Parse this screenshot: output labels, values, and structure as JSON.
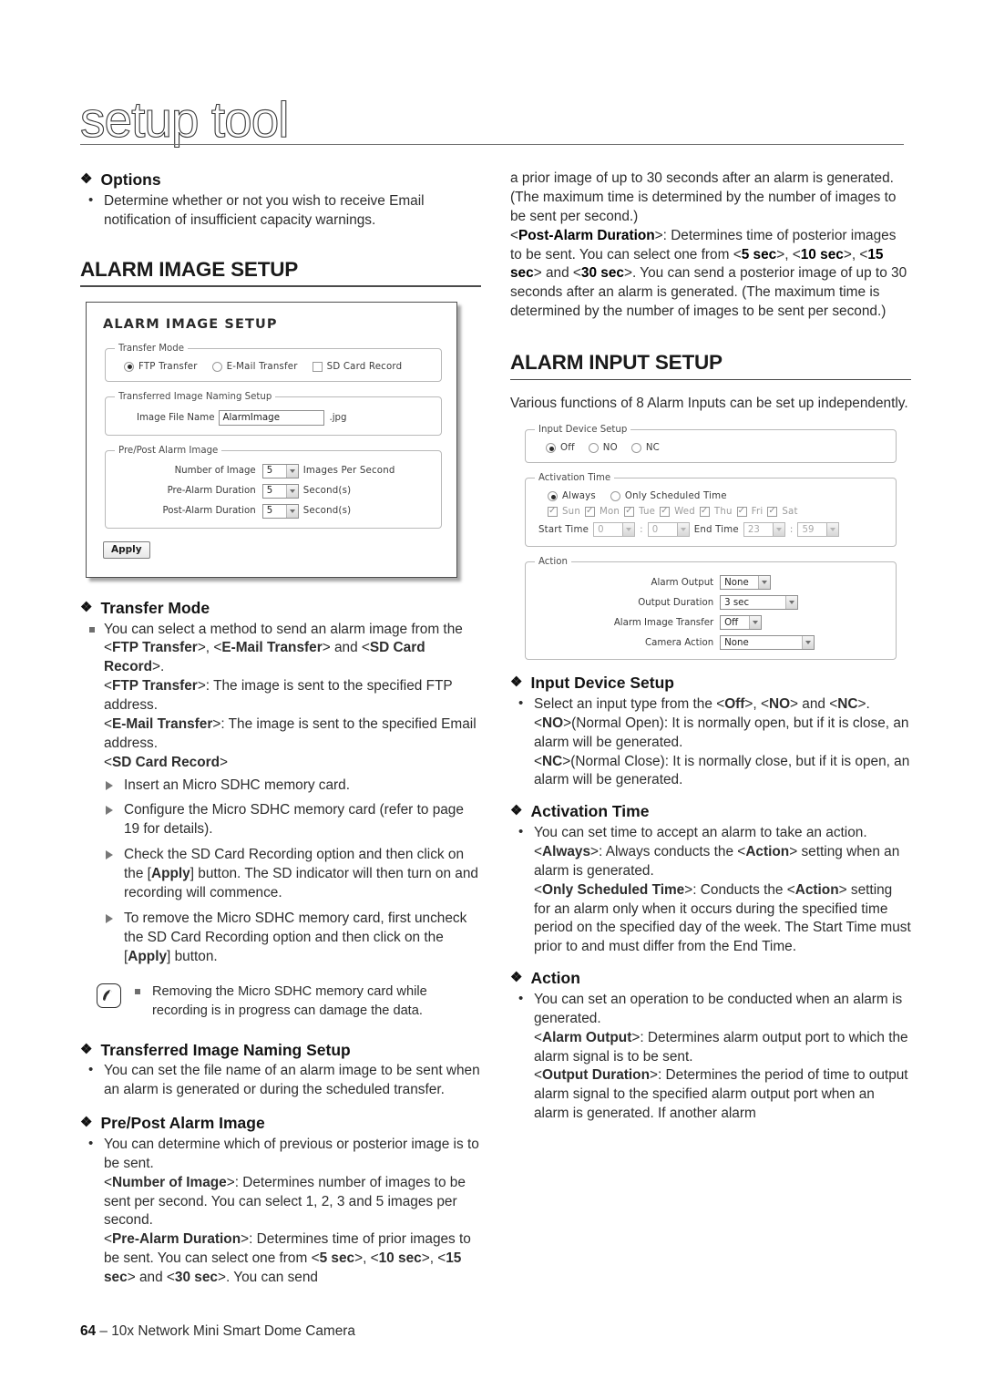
{
  "page": {
    "title": "setup tool",
    "footer_page_number": "64",
    "footer_dash": "–",
    "footer_text": "10x Network Mini Smart Dome Camera"
  },
  "left": {
    "options": {
      "heading": "Options",
      "bullets": [
        "Determine whether or not you wish to receive Email notification of insufficient capacity warnings."
      ]
    },
    "alarm_image_setup": {
      "heading": "ALARM IMAGE SETUP"
    },
    "shot_alarm_image": {
      "title": "ALARM IMAGE SETUP",
      "transfer_mode": {
        "legend": "Transfer Mode",
        "ftp_label": "FTP Transfer",
        "ftp_selected": true,
        "email_label": "E-Mail Transfer",
        "email_selected": false,
        "sd_label": "SD Card Record",
        "sd_checked": false
      },
      "naming": {
        "legend": "Transferred Image Naming Setup",
        "file_name_label": "Image File Name",
        "file_name_value": "AlarmImage",
        "extension": ".jpg"
      },
      "prepost": {
        "legend": "Pre/Post Alarm Image",
        "number_label": "Number of Image",
        "number_value": "5",
        "number_suffix": "Images Per Second",
        "pre_label": "Pre-Alarm Duration",
        "pre_value": "5",
        "pre_suffix": "Second(s)",
        "post_label": "Post-Alarm Duration",
        "post_value": "5",
        "post_suffix": "Second(s)"
      },
      "apply_label": "Apply"
    },
    "transfer_mode": {
      "heading": "Transfer Mode",
      "p1_a": "You can select a method to send an alarm image from the <",
      "p1_b": "FTP Transfer",
      "p1_c": ">, <",
      "p1_d": "E-Mail Transfer",
      "p1_e": "> and <",
      "p1_f": "SD Card Record",
      "p1_g": ">.",
      "p2_a": "<",
      "p2_b": "FTP Transfer",
      "p2_c": ">: The image is sent to the specified FTP address.",
      "p3_a": "<",
      "p3_b": "E-Mail Transfer",
      "p3_c": ">: The image is sent to the specified Email address.",
      "p4_a": "<",
      "p4_b": "SD Card Record",
      "p4_c": ">",
      "steps": [
        "Insert an Micro SDHC memory card.",
        "Configure the Micro SDHC memory card (refer to page 19 for details).",
        "Check the SD Card Recording option and then click on the [Apply] button. The SD indicator will then turn on and recording will commence.",
        "To remove the Micro SDHC memory card, first uncheck the SD Card Recording option and then click on the [Apply] button."
      ],
      "step3_a": "Check the SD Card Recording option and then click on the [",
      "step3_b": "Apply",
      "step3_c": "] button. The SD indicator will then turn on and recording will commence.",
      "step4_a": "To remove the Micro SDHC memory card, first uncheck the SD Card Recording option and then click on the [",
      "step4_b": "Apply",
      "step4_c": "] button."
    },
    "note": {
      "icon": "note-pen-icon",
      "text": "Removing the Micro SDHC memory card while recording is in progress can damage the data."
    },
    "naming_setup": {
      "heading": "Transferred Image Naming Setup",
      "bullet": "You can set the file name of an alarm image to be sent when an alarm is generated or during the scheduled transfer."
    },
    "prepost_alarm": {
      "heading": "Pre/Post Alarm Image",
      "b1": "You can determine which of previous or posterior image is to be sent.",
      "n_a": "<",
      "n_b": "Number of Image",
      "n_c": ">: Determines number of images to be sent per second. You can select 1, 2, 3 and 5 images per second.",
      "pre_a": "<",
      "pre_b": "Pre-Alarm Duration",
      "pre_c": ">: Determines time of prior images to be sent. You can select one from <",
      "pre_d": "5 sec",
      "pre_e": ">, <",
      "pre_f": "10 sec",
      "pre_g": ">, <",
      "pre_h": "15 sec",
      "pre_i": "> and <",
      "pre_j": "30 sec",
      "pre_k": ">. You can send"
    }
  },
  "right": {
    "continuation": {
      "c1": "a prior image of up to 30 seconds after an alarm is generated. (The maximum time is determined by the number of images to be sent per second.)",
      "post_a": "<",
      "post_b": "Post-Alarm Duration",
      "post_c": ">: Determines time of posterior images to be sent. You can select one from <",
      "post_d": "5 sec",
      "post_e": ">, <",
      "post_f": "10 sec",
      "post_g": ">, <",
      "post_h": "15 sec",
      "post_i": "> and <",
      "post_j": "30 sec",
      "post_k": ">. You can send a posterior image of up to 30 seconds after an alarm is generated. (The maximum time is determined by the number of images to be sent per second.)"
    },
    "alarm_input_setup": {
      "heading": "ALARM INPUT SETUP",
      "intro": "Various functions of 8 Alarm Inputs can be set up independently."
    },
    "shot_alarm_input": {
      "input_device": {
        "legend": "Input Device Setup",
        "off_label": "Off",
        "off_selected": true,
        "no_label": "NO",
        "no_selected": false,
        "nc_label": "NC",
        "nc_selected": false
      },
      "activation": {
        "legend": "Activation Time",
        "always_label": "Always",
        "always_selected": true,
        "scheduled_label": "Only Scheduled Time",
        "scheduled_selected": false,
        "days": [
          "Sun",
          "Mon",
          "Tue",
          "Wed",
          "Thu",
          "Fri",
          "Sat"
        ],
        "days_checked": [
          true,
          true,
          true,
          true,
          true,
          true,
          true
        ],
        "start_label": "Start Time",
        "start_hour": "0",
        "start_min": "0",
        "end_label": "End Time",
        "end_hour": "23",
        "end_min": "59",
        "colon": ":"
      },
      "action": {
        "legend": "Action",
        "alarm_output_label": "Alarm Output",
        "alarm_output_value": "None",
        "output_duration_label": "Output Duration",
        "output_duration_value": "3 sec",
        "alarm_image_transfer_label": "Alarm Image Transfer",
        "alarm_image_transfer_value": "Off",
        "camera_action_label": "Camera Action",
        "camera_action_value": "None"
      }
    },
    "input_device_setup": {
      "heading": "Input Device Setup",
      "b1_a": "Select an input type from the <",
      "b1_b": "Off",
      "b1_c": ">, <",
      "b1_d": "NO",
      "b1_e": "> and <",
      "b1_f": "NC",
      "b1_g": ">.",
      "no_a": "<",
      "no_b": "NO",
      "no_c": ">(Normal Open): It is normally open, but if it is close, an alarm will be generated.",
      "nc_a": "<",
      "nc_b": "NC",
      "nc_c": ">(Normal Close): It is normally close, but if it is open, an alarm will be generated."
    },
    "activation_time": {
      "heading": "Activation Time",
      "b1": "You can set time to accept an alarm to take an action.",
      "always_a": "<",
      "always_b": "Always",
      "always_c": ">: Always conducts the <",
      "always_d": "Action",
      "always_e": "> setting when an alarm is generated.",
      "sched_a": "<",
      "sched_b": "Only Scheduled Time",
      "sched_c": ">: Conducts the <",
      "sched_d": "Action",
      "sched_e": "> setting for an alarm only when it occurs during the specified time period on the specified day of the week. The Start Time must prior to and must differ from the End Time."
    },
    "action": {
      "heading": "Action",
      "b1": "You can set an operation to be conducted when an alarm is generated.",
      "ao_a": "<",
      "ao_b": "Alarm Output",
      "ao_c": ">: Determines alarm output port to which the alarm signal is to be sent.",
      "od_a": "<",
      "od_b": "Output Duration",
      "od_c": ">: Determines the period of time to output alarm signal to the specified alarm output port when an alarm is generated. If another alarm"
    }
  },
  "icons": {
    "diamond_bullet": "❖"
  }
}
